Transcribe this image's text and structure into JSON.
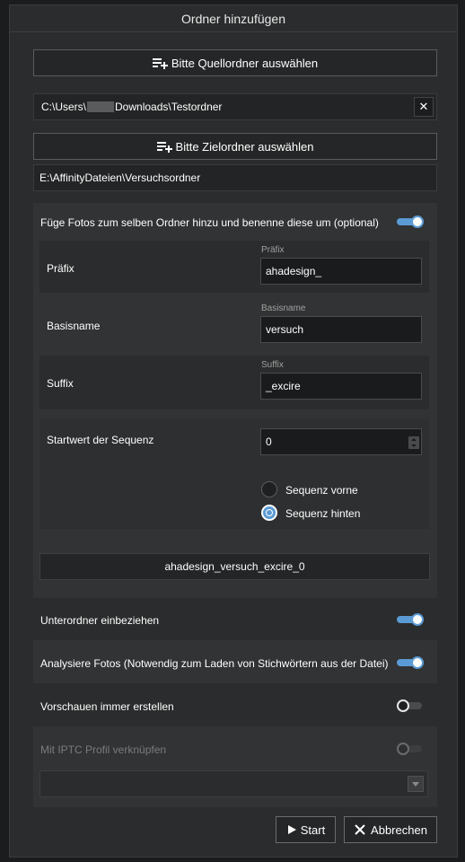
{
  "dialog": {
    "title": "Ordner hinzufügen"
  },
  "source": {
    "button_label": "Bitte Quellordner auswählen",
    "path_prefix": "C:\\Users\\",
    "path_suffix": "Downloads\\Testordner",
    "clear_label": "✕"
  },
  "target": {
    "button_label": "Bitte Zielordner auswählen",
    "path": "E:\\AffinityDateien\\Versuchsordner"
  },
  "rename": {
    "label": "Füge Fotos zum selben Ordner hinzu und benenne diese um (optional)",
    "enabled": true,
    "prefix": {
      "row_label": "Präfix",
      "field_label": "Präfix",
      "value": "ahadesign_"
    },
    "basename": {
      "row_label": "Basisname",
      "field_label": "Basisname",
      "value": "versuch"
    },
    "suffix": {
      "row_label": "Suffix",
      "field_label": "Suffix",
      "value": "_excire"
    },
    "sequence": {
      "row_label": "Startwert der Sequenz",
      "value": "0",
      "option_front": "Sequenz vorne",
      "option_back": "Sequenz hinten",
      "selected": "back"
    },
    "preview": "ahadesign_versuch_excire_0"
  },
  "options": {
    "subfolders": {
      "label": "Unterordner einbeziehen",
      "enabled": true
    },
    "analyze": {
      "label": "Analysiere Fotos (Notwendig zum Laden von Stichwörtern aus der Datei)",
      "enabled": true
    },
    "previews": {
      "label": "Vorschauen immer erstellen",
      "enabled": false
    },
    "iptc": {
      "label": "Mit IPTC Profil verknüpfen",
      "enabled": false,
      "disabled": true,
      "selected_profile": ""
    }
  },
  "footer": {
    "start_label": "Start",
    "cancel_label": "Abbrechen"
  },
  "colors": {
    "accent": "#5b9bd5",
    "background": "#2b2c2d",
    "panel": "#323334"
  }
}
